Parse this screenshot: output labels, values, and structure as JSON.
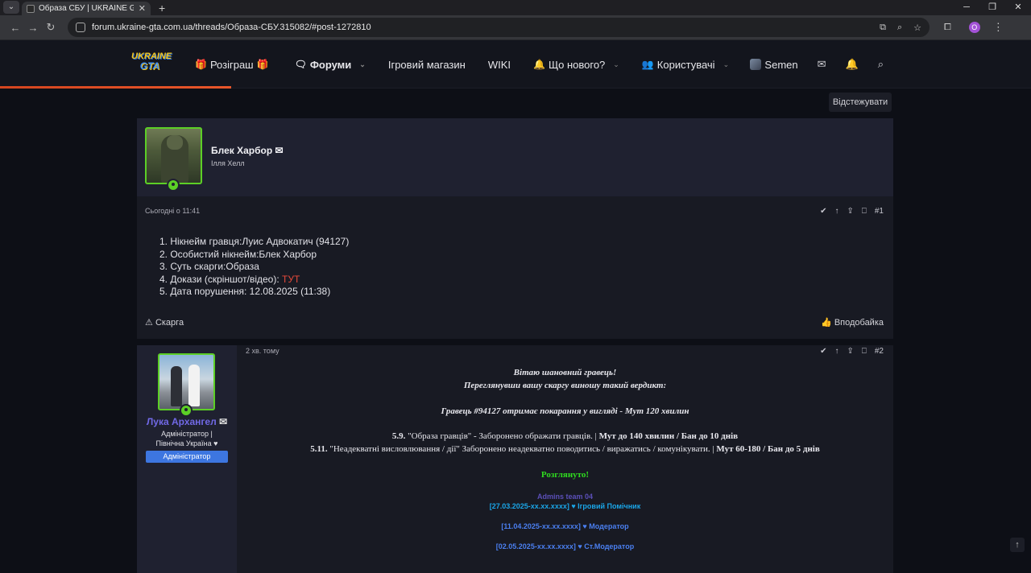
{
  "browser": {
    "tab_title": "Образа СБУ | UKRAINE GTA - I…",
    "new_tab": "+",
    "url": "forum.ukraine-gta.com.ua/threads/Образа-СБУ.315082/#post-1272810",
    "profile_initial": "O"
  },
  "site": {
    "logo_line1": "UKRAINE",
    "logo_line2": "GTA",
    "nav": {
      "giveaway": "Розіграш",
      "forums": "Форуми",
      "shop": "Ігровий магазин",
      "wiki": "WIKI",
      "whats_new": "Що нового?",
      "users": "Користувачі"
    },
    "user": "Semen"
  },
  "thread": {
    "watch_label": "Відстежувати"
  },
  "op": {
    "author": "Блек Харбор",
    "author_title": "Ілля Хелл",
    "time": "Сьогодні о 11:41",
    "post_number": "#1",
    "lines": {
      "l1": "1. Нікнейм гравця:Луис Адвокатич (94127)",
      "l2": "2. Особистий нікнейм:Блек Харбор",
      "l3": "3. Суть скарги:Образа",
      "l4_prefix": "4. Докази (скріншот/відео): ",
      "l4_link": "ТУТ",
      "l5": "5. Дата порушення: 12.08.2025 (11:38)"
    },
    "report_label": "Скарга",
    "like_label": "Вподобайка"
  },
  "reply": {
    "author": "Лука Архангел",
    "title_line1": "Адміністратор |",
    "title_line2": "Північна Україна ♥",
    "badge": "Адміністратор",
    "time": "2 хв. тому",
    "post_number": "#2",
    "greet1": "Вітаю шановний гравець!",
    "greet2": "Переглянувши вашу скаргу виношу такий вердикт:",
    "verdict": "Гравець #94127 отримає покарання у вигляді - Мут 120 хвилин",
    "rule1_num": "5.9.",
    "rule1_text": " \"Образа гравців\" - Заборонено ображати гравців. | ",
    "rule1_pen": "Мут до 140 хвилин / Бан до 10 днів",
    "rule2_num": "5.11.",
    "rule2_text": " \"Неадекватні висловлювання / дії\" Заборонено неадекватно поводитись / виражатись / комунікувати. | ",
    "rule2_pen": "Мут 60-180 / Бан до 5 днів",
    "status": "Розглянуто!",
    "sig_team": "Admins team 04",
    "sig1": "[27.03.2025-xx.xx.xxxx] ♥ Ігровий Помічник",
    "sig2": "[11.04.2025-xx.xx.xxxx] ♥ Модератор",
    "sig3": "[02.05.2025-xx.xx.xxxx] ♥ Ст.Модератор"
  },
  "colors": {
    "accent_orange": "#e8562a",
    "online_green": "#5ccf26",
    "admin_blue": "#3d76e0",
    "admin_name": "#7169e6"
  }
}
